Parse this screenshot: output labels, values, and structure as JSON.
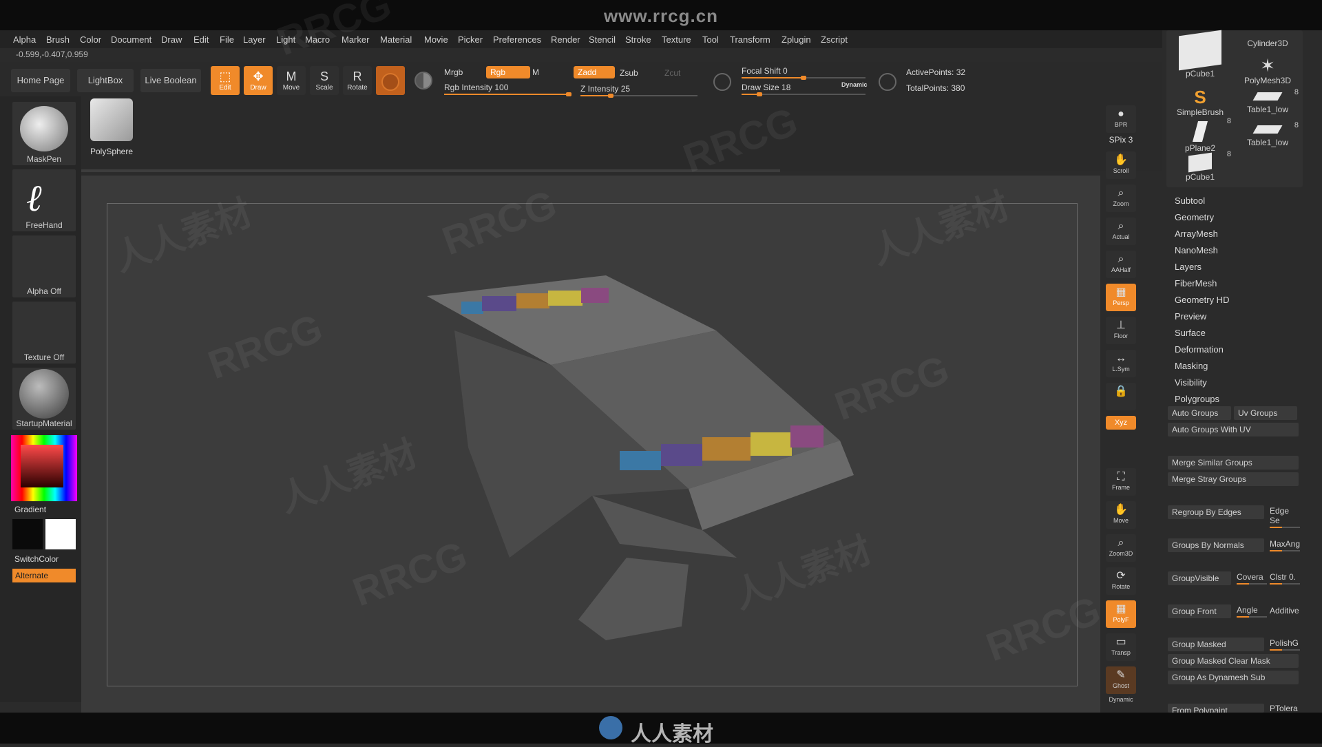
{
  "watermark_top": "www.rrcg.cn",
  "watermark_bottom": "人人素材",
  "watermark_overlay": [
    "RRCG",
    "人人素材"
  ],
  "menu": [
    "Alpha",
    "Brush",
    "Color",
    "Document",
    "Draw",
    "Edit",
    "File",
    "Layer",
    "Light",
    "Macro",
    "Marker",
    "Material",
    "Movie",
    "Picker",
    "Preferences",
    "Render",
    "Stencil",
    "Stroke",
    "Texture",
    "Tool",
    "Transform",
    "Zplugin",
    "Zscript"
  ],
  "coords": "-0.599,-0.407,0.959",
  "nav": {
    "home": "Home Page",
    "lightbox": "LightBox",
    "liveboolean": "Live Boolean"
  },
  "modes": {
    "edit": "Edit",
    "draw": "Draw",
    "move": "Move",
    "scale": "Scale",
    "rotate": "Rotate"
  },
  "shelf": {
    "mrgb": "Mrgb",
    "rgb": "Rgb",
    "m": "M",
    "zadd": "Zadd",
    "zsub": "Zsub",
    "zcut": "Zcut",
    "rgb_intensity": "Rgb Intensity 100",
    "z_intensity": "Z Intensity 25",
    "focal_shift": "Focal Shift 0",
    "draw_size": "Draw Size 18",
    "dynamic": "Dynamic",
    "active_points": "ActivePoints: 32",
    "total_points": "TotalPoints: 380"
  },
  "left": {
    "brush": "MaskPen",
    "stroke": "FreeHand",
    "alpha": "Alpha Off",
    "texture": "Texture Off",
    "material": "StartupMaterial",
    "gradient": "Gradient",
    "switchcolor": "SwitchColor",
    "alternate": "Alternate"
  },
  "shelf_tool": "PolySphere",
  "rtools": [
    {
      "label": "BPR",
      "icon": "render-sphere-icon"
    },
    {
      "label": "SPix 3",
      "icon": ""
    },
    {
      "label": "Scroll",
      "icon": "scroll-icon"
    },
    {
      "label": "Zoom",
      "icon": "zoom-icon"
    },
    {
      "label": "Actual",
      "icon": "actual-icon"
    },
    {
      "label": "AAHalf",
      "icon": "aahalf-icon"
    },
    {
      "label": "Persp",
      "icon": "persp-icon"
    },
    {
      "label": "Floor",
      "icon": "floor-icon"
    },
    {
      "label": "L.Sym",
      "icon": "lsym-icon"
    },
    {
      "label": "",
      "icon": "lock-icon"
    },
    {
      "label": "Xyz",
      "icon": "xyz-icon"
    },
    {
      "label": "Frame",
      "icon": "frame-icon"
    },
    {
      "label": "Move",
      "icon": "move-icon"
    },
    {
      "label": "Zoom3D",
      "icon": "zoom3d-icon"
    },
    {
      "label": "Rotate",
      "icon": "rotate-icon"
    },
    {
      "label": "PolyF",
      "icon": "polyf-icon"
    },
    {
      "label": "Transp",
      "icon": "transp-icon"
    },
    {
      "label": "Ghost",
      "icon": "ghost-icon"
    },
    {
      "label": "Dynamic",
      "icon": ""
    }
  ],
  "tools": [
    {
      "name": "pCube1",
      "count": ""
    },
    {
      "name": "Cylinder3D",
      "count": ""
    },
    {
      "name": "PolyMesh3D",
      "count": ""
    },
    {
      "name": "SimpleBrush",
      "count": ""
    },
    {
      "name": "Table1_low",
      "count": "8"
    },
    {
      "name": "pPlane2",
      "count": "8"
    },
    {
      "name": "Table1_low",
      "count": "8"
    },
    {
      "name": "pCube1",
      "count": "8"
    }
  ],
  "subpalettes": [
    "Subtool",
    "Geometry",
    "ArrayMesh",
    "NanoMesh",
    "Layers",
    "FiberMesh",
    "Geometry HD",
    "Preview",
    "Surface",
    "Deformation",
    "Masking",
    "Visibility",
    "Polygroups"
  ],
  "polygroups": {
    "auto_groups": "Auto Groups",
    "uv_groups": "Uv Groups",
    "auto_groups_uv": "Auto Groups With UV",
    "merge_similar": "Merge Similar Groups",
    "merge_stray": "Merge Stray Groups",
    "regroup_edges": "Regroup By Edges",
    "edge_se": "Edge Se",
    "groups_normals": "Groups By Normals",
    "maxang": "MaxAng",
    "groupvisible": "GroupVisible",
    "coverage": "Covera",
    "clstr": "Clstr 0.",
    "group_front": "Group Front",
    "angle": "Angle",
    "additive": "Additive",
    "group_masked": "Group Masked",
    "polishg": "PolishG",
    "group_masked_clear": "Group Masked Clear Mask",
    "group_dynamesh": "Group As Dynamesh Sub",
    "from_polypaint": "From Polypaint",
    "ptolera": "PTolera"
  },
  "colors": {
    "accent": "#f08a2a",
    "bg": "#2b2b2b"
  }
}
